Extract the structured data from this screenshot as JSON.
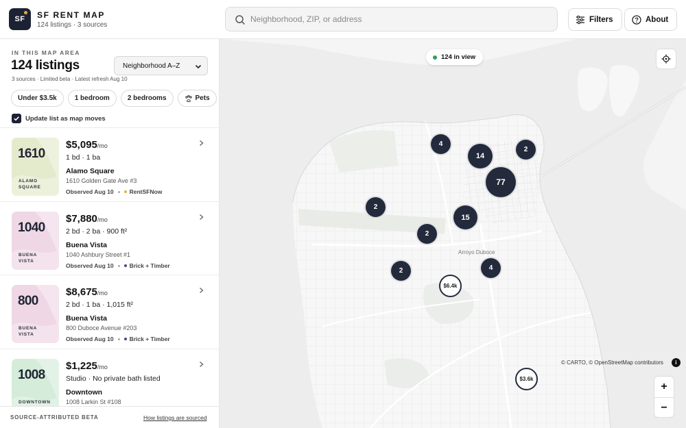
{
  "app": {
    "logo_text": "SF",
    "title": "SF RENT MAP",
    "subtitle": "124 listings · 3 sources"
  },
  "search": {
    "placeholder": "Neighborhood, ZIP, or address",
    "value": ""
  },
  "header_buttons": {
    "filters": "Filters",
    "about": "About"
  },
  "summary": {
    "eyebrow": "IN THIS MAP AREA",
    "count": "124 listings",
    "meta": "3 sources · Limited beta · Latest refresh Aug 10",
    "sort_selected": "Neighborhood A–Z"
  },
  "chips": [
    "Under $3.5k",
    "1 bedroom",
    "2 bedrooms",
    "Pets"
  ],
  "update_toggle": {
    "label": "Update list as map moves",
    "checked": true
  },
  "listings": [
    {
      "thumb_num": "1610",
      "thumb_area": "ALAMO SQUARE",
      "price": "$5,095",
      "unit": "/mo",
      "specs": "1 bd · 1 ba",
      "neighborhood": "Alamo Square",
      "address": "1610 Golden Gate Ave #3",
      "observed": "Observed Aug 10",
      "source": "RentSFNow",
      "source_color": "#e3b341",
      "thumb_color": "#e4ebcc"
    },
    {
      "thumb_num": "1040",
      "thumb_area": "BUENA VISTA",
      "price": "$7,880",
      "unit": "/mo",
      "specs": "2 bd · 2 ba · 900 ft²",
      "neighborhood": "Buena Vista",
      "address": "1040 Ashbury Street #1",
      "observed": "Observed Aug 10",
      "source": "Brick + Timber",
      "source_color": "#5b3f7a",
      "thumb_color": "#efd7e6"
    },
    {
      "thumb_num": "800",
      "thumb_area": "BUENA VISTA",
      "price": "$8,675",
      "unit": "/mo",
      "specs": "2 bd · 1 ba · 1,015 ft²",
      "neighborhood": "Buena Vista",
      "address": "800 Duboce Avenue #203",
      "observed": "Observed Aug 10",
      "source": "Brick + Timber",
      "source_color": "#5b3f7a",
      "thumb_color": "#efd7e6"
    },
    {
      "thumb_num": "1008",
      "thumb_area": "DOWNTOWN",
      "price": "$1,225",
      "unit": "/mo",
      "specs": "Studio · No private bath listed",
      "neighborhood": "Downtown",
      "address": "1008 Larkin St #108",
      "observed": "Observed Aug 10",
      "source": "",
      "source_color": "#e3b341",
      "thumb_color": "#d4ecd9"
    }
  ],
  "footer": {
    "left": "SOURCE-ATTRIBUTED BETA",
    "right": "How listings are sourced"
  },
  "map": {
    "in_view": "124 in view",
    "street_label": "Arroyo Duboce",
    "clusters": [
      "4",
      "14",
      "2",
      "77",
      "2",
      "15",
      "2",
      "2",
      "4"
    ],
    "price_pins": [
      "$6.4k",
      "$3.6k"
    ],
    "attribution": "© CARTO, © OpenStreetMap contributors",
    "info_icon_text": "i",
    "zoom_in": "+",
    "zoom_out": "−"
  },
  "icons": {
    "search": "search-icon",
    "filters": "sliders-icon",
    "about": "help-circle-icon",
    "locate": "crosshair-icon",
    "pets": "paw-icon",
    "chevron": "chevron-right-icon"
  }
}
